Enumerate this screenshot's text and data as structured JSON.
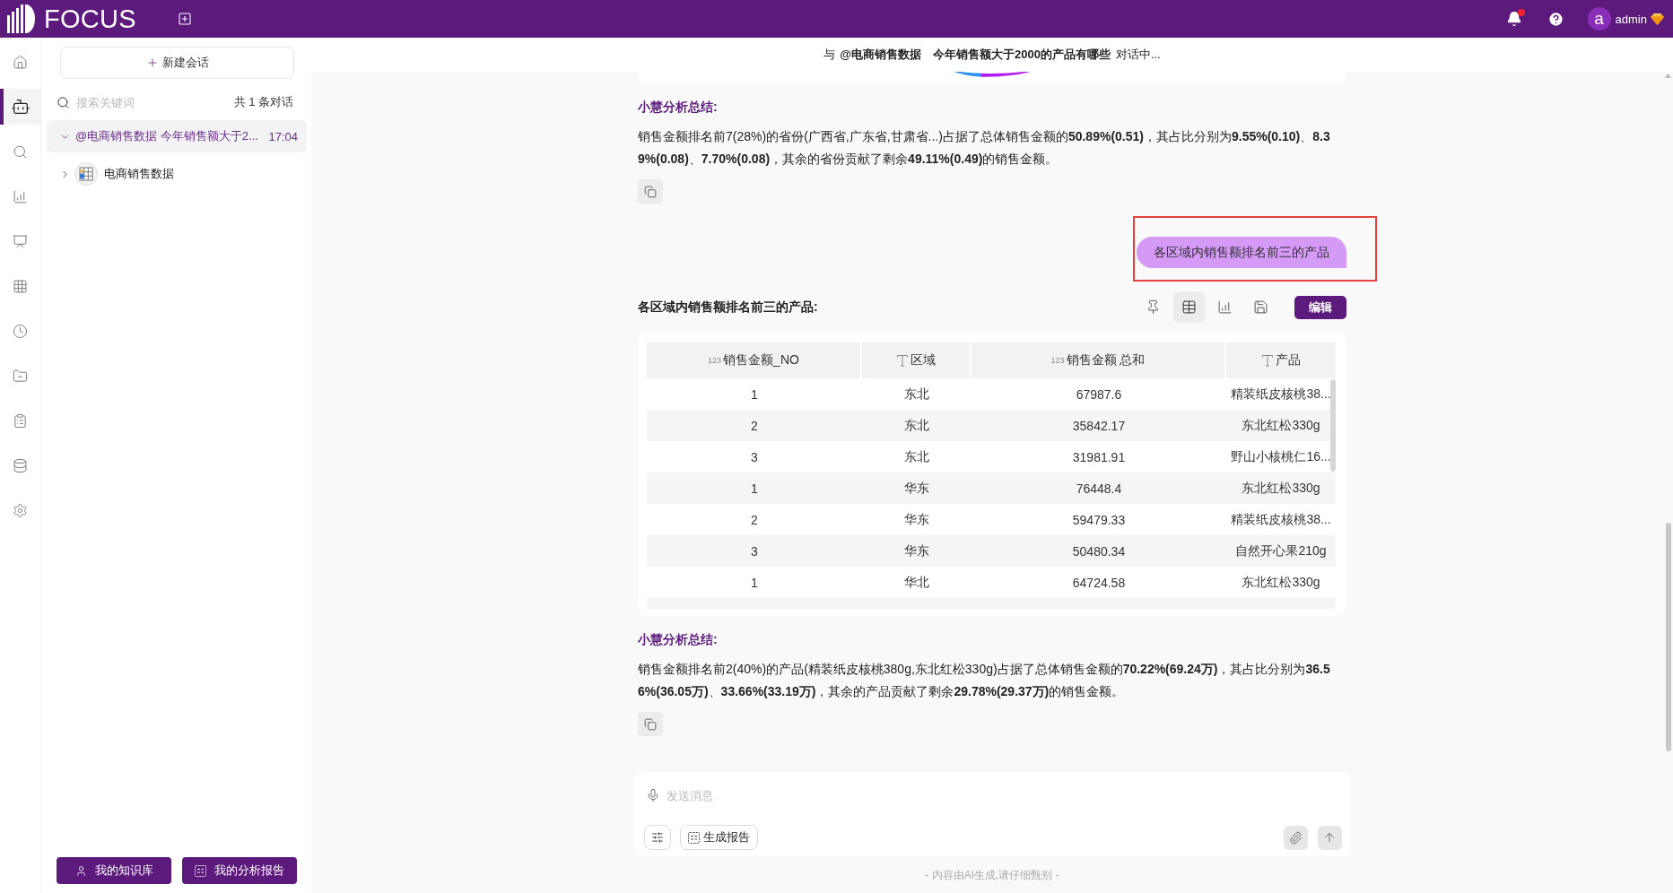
{
  "top_bar": {
    "logo_text": "FOCUS",
    "notifications": {
      "unread": true
    },
    "user": {
      "avatar_letter": "a",
      "name": "admin"
    }
  },
  "nav_rail": {
    "items": [
      {
        "selected": false
      },
      {
        "selected": true
      },
      {
        "selected": false
      },
      {
        "selected": false
      },
      {
        "selected": false
      },
      {
        "selected": false
      },
      {
        "selected": false
      },
      {
        "selected": false
      },
      {
        "selected": false
      },
      {
        "selected": false
      },
      {
        "selected": false
      }
    ]
  },
  "sidebar": {
    "new_chat_button": "新建会话",
    "search": {
      "placeholder": "搜索关键词"
    },
    "count": "共 1 条对话",
    "conversations": [
      {
        "title": "@电商销售数据 今年销售额大于2...",
        "time": "17:04",
        "selected": true,
        "expanded": true,
        "children": [
          {
            "label": "电商销售数据",
            "expanded": false
          }
        ]
      }
    ],
    "buttons": [
      {
        "kind": "knowledge",
        "label": "我的知识库"
      },
      {
        "kind": "report",
        "label": "我的分析报告"
      }
    ]
  },
  "chat_header": {
    "prefix": "与",
    "dataset": "@电商销售数据",
    "question": "今年销售额大于2000的产品有哪些",
    "status": "对话中..."
  },
  "messages": [
    {
      "kind": "chart_card"
    },
    {
      "kind": "summary",
      "title": "小慧分析总结:",
      "text": "销售金额排名前7(28%)的省份(广西省,广东省,甘肃省...)占据了总体销售金额的**50.89%(0.51)**，其占比分别为**9.55%(0.10)**、**8.39%(0.08)**、**7.70%(0.08)**，其余的省份贡献了剩余**49.11%(0.49)**的销售金额。"
    },
    {
      "kind": "user",
      "text": "各区域内销售额排名前三的产品",
      "highlighted": true
    },
    {
      "kind": "table_result",
      "title": "各区域内销售额排名前三的产品:",
      "tools": [
        {
          "selected": false
        },
        {
          "selected": true
        },
        {
          "selected": false
        },
        {
          "selected": false
        }
      ],
      "edit_button": "编辑",
      "columns": [
        {
          "kind": "number",
          "tag": "123",
          "label": "销售金额_NO"
        },
        {
          "kind": "text",
          "label": "区域"
        },
        {
          "kind": "number",
          "tag": "123",
          "label": "销售金额 总和"
        },
        {
          "kind": "text",
          "label": "产品"
        }
      ],
      "rows": [
        [
          "1",
          "东北",
          "67987.6",
          "精装纸皮核桃38..."
        ],
        [
          "2",
          "东北",
          "35842.17",
          "东北红松330g"
        ],
        [
          "3",
          "东北",
          "31981.91",
          "野山小核桃仁16..."
        ],
        [
          "1",
          "华东",
          "76448.4",
          "东北红松330g"
        ],
        [
          "2",
          "华东",
          "59479.33",
          "精装纸皮核桃38..."
        ],
        [
          "3",
          "华东",
          "50480.34",
          "自然开心果210g"
        ],
        [
          "1",
          "华北",
          "64724.58",
          "东北红松330g"
        ]
      ]
    },
    {
      "kind": "summary",
      "title": "小慧分析总结:",
      "text": "销售金额排名前2(40%)的产品(精装纸皮核桃380g,东北红松330g)占据了总体销售金额的**70.22%(69.24万)**，其占比分别为**36.56%(36.05万)**、**33.66%(33.19万)**，其余的产品贡献了剩余**29.78%(29.37万)**的销售金额。"
    }
  ],
  "composer": {
    "placeholder": "发送消息",
    "report_button": "生成报告"
  },
  "footer": "- 内容由AI生成,请仔细甄别 -"
}
